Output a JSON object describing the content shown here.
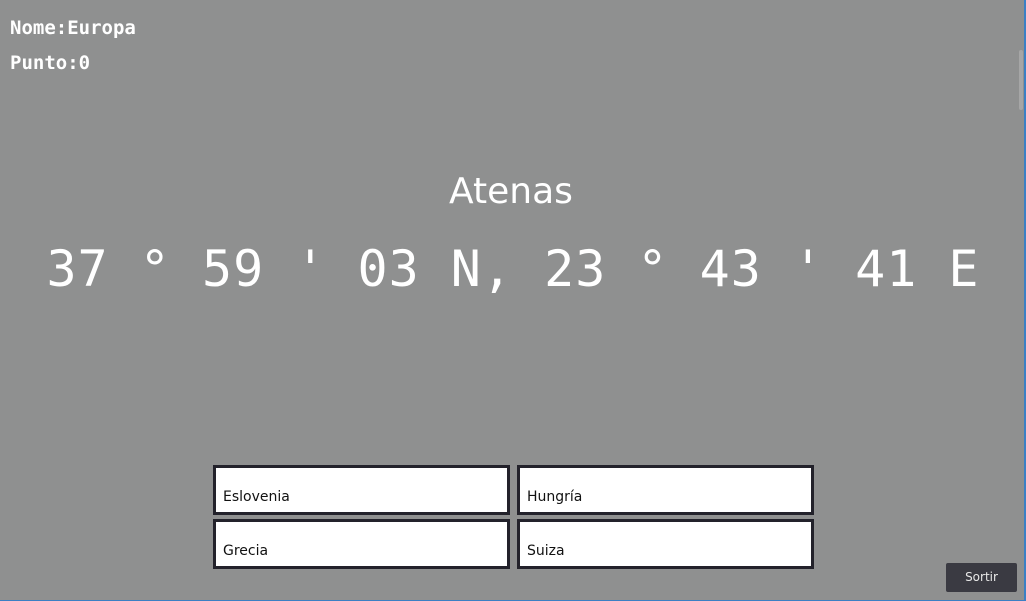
{
  "hud": {
    "name_line": "Nome:Europa",
    "score_line": "Punto:0"
  },
  "question": {
    "city": "Atenas",
    "coordinates": "37 ° 59 ' 03 N, 23 ° 43 ' 41 E"
  },
  "answers": [
    {
      "label": "Eslovenia"
    },
    {
      "label": "Hungría"
    },
    {
      "label": "Grecia"
    },
    {
      "label": "Suiza"
    }
  ],
  "controls": {
    "quit_label": "Sortir"
  },
  "colors": {
    "background": "#8f9090",
    "answer_border": "#23222b",
    "quit_button": "#3a3a42",
    "frame_accent": "#3b7fc4"
  }
}
